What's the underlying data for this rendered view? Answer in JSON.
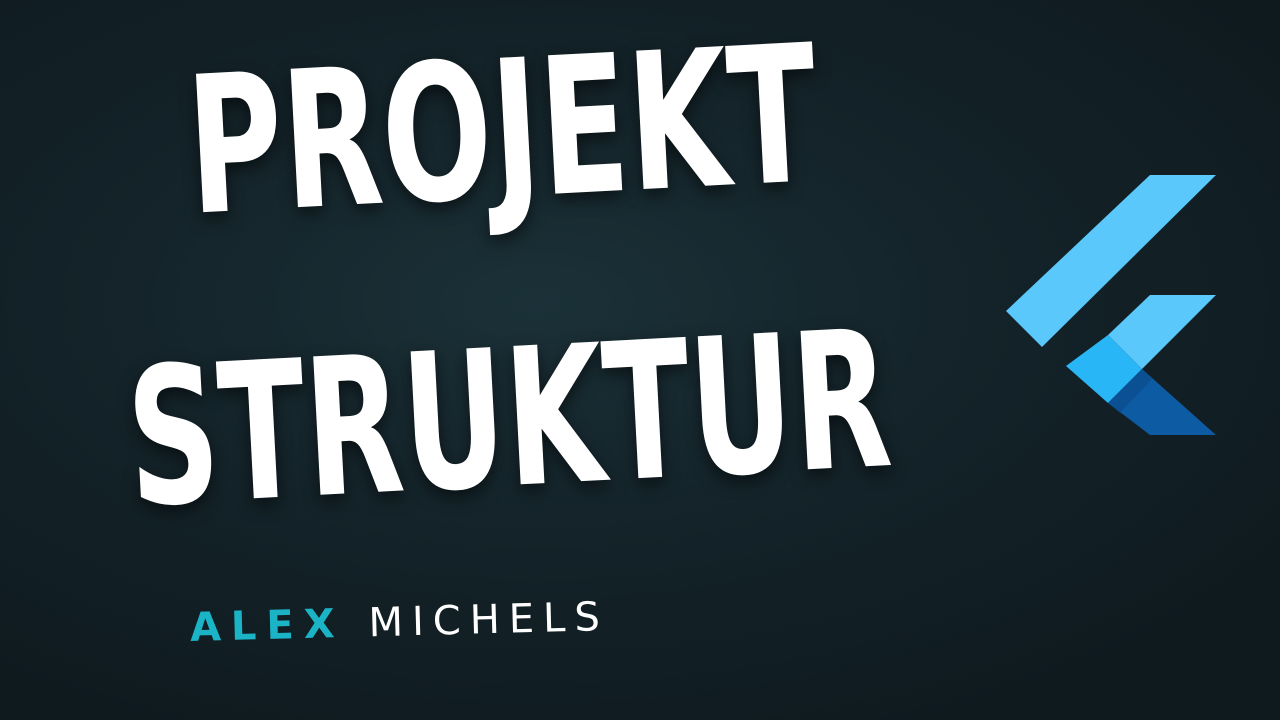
{
  "title": {
    "line1": "PROJEKT",
    "line2": "STRUKTUR"
  },
  "author": {
    "first_name": "ALEX",
    "last_name": "MICHELS"
  },
  "logo": {
    "icon": "flutter-logo-icon",
    "colors": {
      "light": "#5ac8fa",
      "mid": "#29b6f6",
      "dark": "#0d5ba3"
    }
  },
  "colors": {
    "background": "#14242a",
    "title_text": "#ffffff",
    "author_first": "#1bb3c6",
    "author_last": "#ffffff"
  }
}
